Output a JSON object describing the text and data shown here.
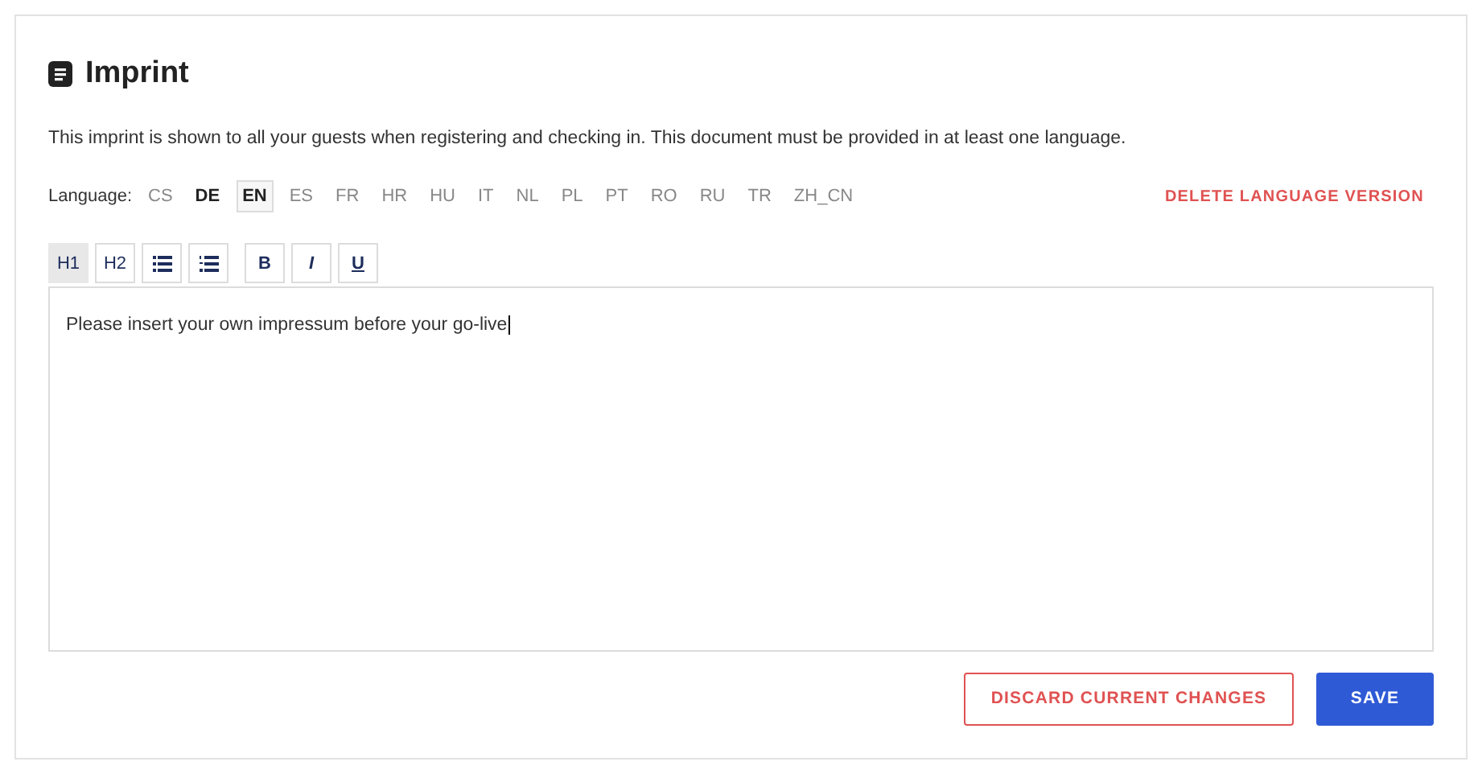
{
  "title": "Imprint",
  "description": "This imprint is shown to all your guests when registering and checking in. This document must be provided in at least one language.",
  "language_label": "Language:",
  "languages": [
    {
      "code": "CS",
      "selected": false,
      "filled": false
    },
    {
      "code": "DE",
      "selected": false,
      "filled": true
    },
    {
      "code": "EN",
      "selected": true,
      "filled": true
    },
    {
      "code": "ES",
      "selected": false,
      "filled": false
    },
    {
      "code": "FR",
      "selected": false,
      "filled": false
    },
    {
      "code": "HR",
      "selected": false,
      "filled": false
    },
    {
      "code": "HU",
      "selected": false,
      "filled": false
    },
    {
      "code": "IT",
      "selected": false,
      "filled": false
    },
    {
      "code": "NL",
      "selected": false,
      "filled": false
    },
    {
      "code": "PL",
      "selected": false,
      "filled": false
    },
    {
      "code": "PT",
      "selected": false,
      "filled": false
    },
    {
      "code": "RO",
      "selected": false,
      "filled": false
    },
    {
      "code": "RU",
      "selected": false,
      "filled": false
    },
    {
      "code": "TR",
      "selected": false,
      "filled": false
    },
    {
      "code": "ZH_CN",
      "selected": false,
      "filled": false
    }
  ],
  "delete_link": "DELETE LANGUAGE VERSION",
  "toolbar": [
    [
      {
        "kind": "text",
        "label": "H1",
        "selected": true
      },
      {
        "kind": "text",
        "label": "H2",
        "selected": false
      },
      {
        "kind": "bullets",
        "selected": false
      },
      {
        "kind": "numbers",
        "selected": false
      }
    ],
    [
      {
        "kind": "bold",
        "label": "B",
        "selected": false
      },
      {
        "kind": "italic",
        "label": "I",
        "selected": false
      },
      {
        "kind": "underline",
        "label": "U",
        "selected": false
      }
    ]
  ],
  "editor_text": "Please insert your own impressum before your go-live",
  "discard_button": "DISCARD CURRENT CHANGES",
  "save_button": "SAVE"
}
